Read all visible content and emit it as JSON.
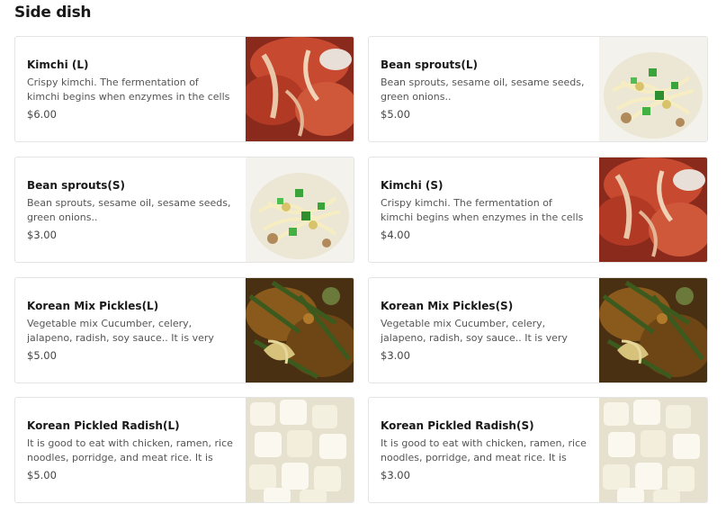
{
  "section": {
    "title": "Side dish"
  },
  "items": [
    {
      "name": "Kimchi (L)",
      "description": "Crispy kimchi. The fermentation of kimchi begins when enzymes in the cells of…",
      "price": "$6.00",
      "image": "kimchi"
    },
    {
      "name": "Bean sprouts(L)",
      "description": "Bean sprouts, sesame oil, sesame seeds, green onions..",
      "price": "$5.00",
      "image": "bean-sprouts"
    },
    {
      "name": "Bean sprouts(S)",
      "description": "Bean sprouts, sesame oil, sesame seeds, green onions..",
      "price": "$3.00",
      "image": "bean-sprouts"
    },
    {
      "name": "Kimchi (S)",
      "description": "Crispy kimchi. The fermentation of kimchi begins when enzymes in the cells of…",
      "price": "$4.00",
      "image": "kimchi"
    },
    {
      "name": "Korean Mix Pickles(L)",
      "description": "Vegetable mix Cucumber, celery, jalapeno, radish, soy sauce.. It is very good to eat wit…",
      "price": "$5.00",
      "image": "mix-pickles"
    },
    {
      "name": "Korean Mix Pickles(S)",
      "description": "Vegetable mix Cucumber, celery, jalapeno, radish, soy sauce.. It is very good to eat wit…",
      "price": "$3.00",
      "image": "mix-pickles"
    },
    {
      "name": "Korean Pickled Radish(L)",
      "description": "It is good to eat with chicken, ramen, rice noodles, porridge, and meat rice. It is mad…",
      "price": "$5.00",
      "image": "pickled-radish"
    },
    {
      "name": "Korean Pickled Radish(S)",
      "description": "It is good to eat with chicken, ramen, rice noodles, porridge, and meat rice. It is mad…",
      "price": "$3.00",
      "image": "pickled-radish"
    }
  ]
}
